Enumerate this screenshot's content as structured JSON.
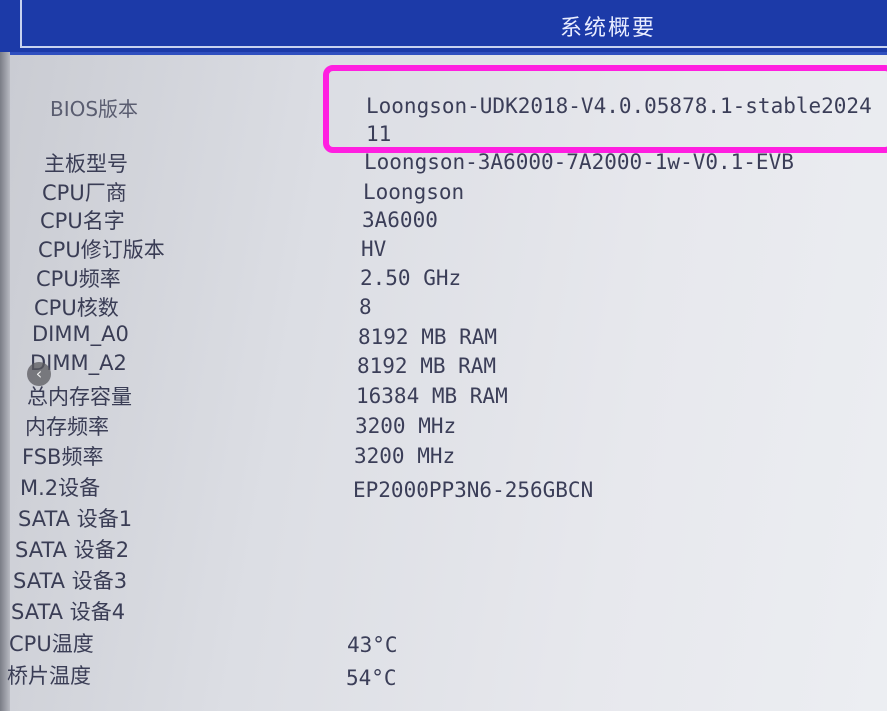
{
  "header": {
    "title": "系统概要"
  },
  "rows": [
    {
      "label": "BIOS版本",
      "value": "Loongson-UDK2018-V4.0.05878.1-stable2024",
      "value2": "11"
    },
    {
      "label": "主板型号",
      "value": "Loongson-3A6000-7A2000-1w-V0.1-EVB"
    },
    {
      "label": "CPU厂商",
      "value": "Loongson"
    },
    {
      "label": "CPU名字",
      "value": "3A6000"
    },
    {
      "label": "CPU修订版本",
      "value": "HV"
    },
    {
      "label": "CPU频率",
      "value": "2.50 GHz"
    },
    {
      "label": "CPU核数",
      "value": "8"
    },
    {
      "label": "DIMM_A0",
      "value": "8192 MB RAM"
    },
    {
      "label": "DIMM_A2",
      "value": "8192 MB RAM"
    },
    {
      "label": "总内存容量",
      "value": "16384 MB RAM"
    },
    {
      "label": "内存频率",
      "value": "3200 MHz"
    },
    {
      "label": "FSB频率",
      "value": "3200 MHz"
    },
    {
      "label": "M.2设备",
      "value": "EP2000PP3N6-256GBCN"
    },
    {
      "label": "SATA 设备1",
      "value": ""
    },
    {
      "label": "SATA 设备2",
      "value": ""
    },
    {
      "label": "SATA 设备3",
      "value": ""
    },
    {
      "label": "SATA 设备4",
      "value": ""
    },
    {
      "label": "CPU温度",
      "value": "43°C"
    },
    {
      "label": "桥片温度",
      "value": "54°C"
    }
  ],
  "colors": {
    "highlight": "#ff1fe0",
    "header_bg": "#1c3aa8"
  },
  "icons": {
    "nav_arrow": "chevron-left-icon"
  }
}
